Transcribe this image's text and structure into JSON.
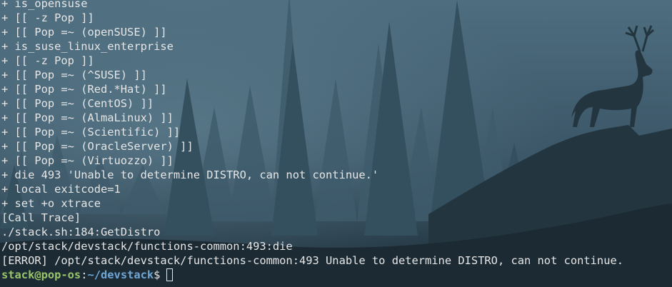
{
  "terminal": {
    "lines": [
      "+ is_opensuse",
      "+ [[ -z Pop ]]",
      "+ [[ Pop =~ (openSUSE) ]]",
      "+ is_suse_linux_enterprise",
      "+ [[ -z Pop ]]",
      "+ [[ Pop =~ (^SUSE) ]]",
      "+ [[ Pop =~ (Red.*Hat) ]]",
      "+ [[ Pop =~ (CentOS) ]]",
      "+ [[ Pop =~ (AlmaLinux) ]]",
      "+ [[ Pop =~ (Scientific) ]]",
      "+ [[ Pop =~ (OracleServer) ]]",
      "+ [[ Pop =~ (Virtuozzo) ]]",
      "+ die 493 'Unable to determine DISTRO, can not continue.'",
      "+ local exitcode=1",
      "+ set +o xtrace",
      "[Call Trace]",
      "./stack.sh:184:GetDistro",
      "/opt/stack/devstack/functions-common:493:die",
      "[ERROR] /opt/stack/devstack/functions-common:493 Unable to determine DISTRO, can not continue."
    ],
    "prompt": {
      "user_host": "stack@pop-os",
      "separator": ":",
      "path": "~/devstack",
      "symbol": "$"
    }
  },
  "colors": {
    "prompt_user": "#98c36b",
    "prompt_path": "#6ea6d6",
    "text": "#e6e6e6",
    "background_sky": "#5a7c8e",
    "background_forest": "#2b4150"
  }
}
